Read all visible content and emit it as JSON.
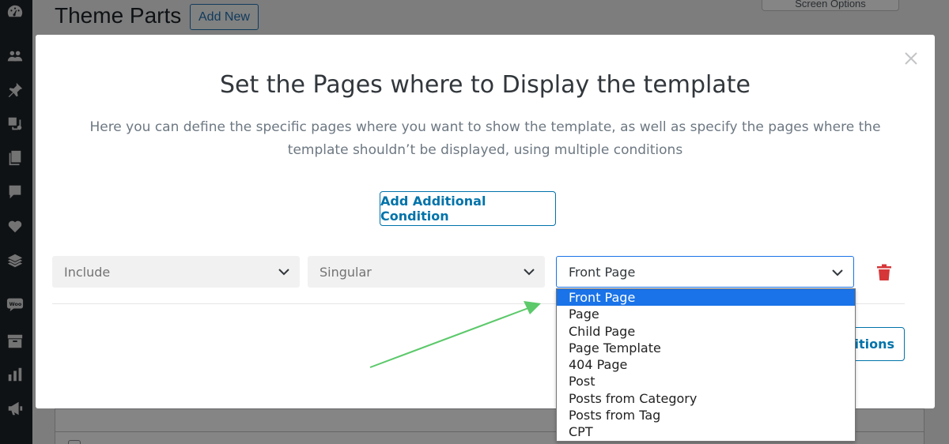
{
  "page": {
    "title": "Theme Parts",
    "add_new_label": "Add New",
    "screen_options_label": "Screen Options"
  },
  "sidebar": {
    "icons": [
      "dashboard-icon",
      "users-icon",
      "pin-icon",
      "media-icon",
      "pages-icon",
      "comments-icon",
      "heart-icon",
      "layers-icon",
      "woo-icon",
      "archive-icon",
      "chart-icon",
      "megaphone-icon"
    ]
  },
  "modal": {
    "title": "Set the Pages where to Display the template",
    "description": "Here you can define the specific pages where you want to show the template, as well as specify the pages where the template shouldn’t be displayed, using multiple conditions",
    "add_condition_label": "Add Additional Condition",
    "save_label_visible": "ditions",
    "condition": {
      "include": "Include",
      "type": "Singular",
      "page": "Front Page"
    },
    "dropdown_options": [
      "Front Page",
      "Page",
      "Child Page",
      "Page Template",
      "404 Page",
      "Post",
      "Posts from Category",
      "Posts from Tag",
      "CPT"
    ],
    "dropdown_selected": "Front Page"
  },
  "colors": {
    "accent": "#0073aa",
    "selection": "#1a73e8",
    "trash": "#d63638",
    "arrow": "#5cc96b"
  }
}
